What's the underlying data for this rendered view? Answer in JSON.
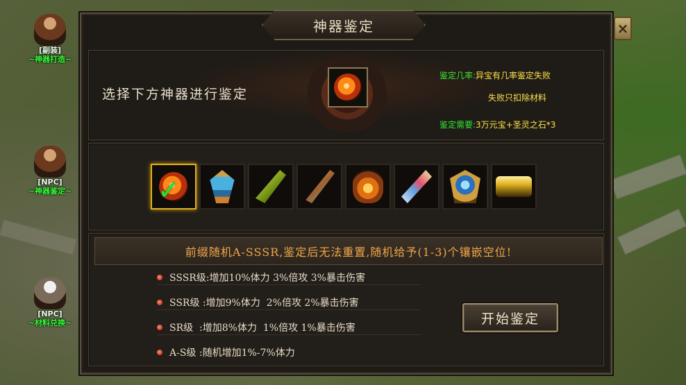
{
  "npcs": [
    {
      "tag": "[副装]",
      "name": "~神器打造~"
    },
    {
      "tag": "[NPC]",
      "name": "~神器鉴定~"
    },
    {
      "tag": "[NPC]",
      "name": "~材料兑换~"
    }
  ],
  "window": {
    "title": "神器鉴定",
    "close_icon": "×"
  },
  "prompt": "选择下方神器进行鉴定",
  "rates": {
    "line1_label": "鉴定几率:",
    "line1_value": "异宝有几率鉴定失败",
    "line2_value": "失败只扣除材料",
    "line3_label": "鉴定需要:",
    "line3_value": "3万元宝+圣灵之石*3"
  },
  "artifacts": [
    {
      "name": "fire-orb",
      "selected": true
    },
    {
      "name": "blue-crystal-totem",
      "selected": false
    },
    {
      "name": "green-bow",
      "selected": false
    },
    {
      "name": "golden-bow",
      "selected": false
    },
    {
      "name": "flame-lantern",
      "selected": false
    },
    {
      "name": "jeweled-staff",
      "selected": false
    },
    {
      "name": "winged-shield",
      "selected": false
    },
    {
      "name": "golden-treasure",
      "selected": false
    }
  ],
  "banner": "前缀随机A-SSSR,鉴定后无法重置,随机给予(1-3)个镶嵌空位!",
  "grades": [
    "SSSR级:增加10%体力 3%倍攻 3%暴击伤害",
    "SSR级 :增加9%体力  2%倍攻 2%暴击伤害",
    "SR级  :增加8%体力  1%倍攻 1%暴击伤害",
    "A-S级 :随机增加1%-7%体力"
  ],
  "start_button": "开始鉴定",
  "colors": {
    "rate_label": "#34e634",
    "rate_value": "#ffe24a",
    "banner_text": "#f2a64a",
    "selected_border": "#e0b020"
  }
}
